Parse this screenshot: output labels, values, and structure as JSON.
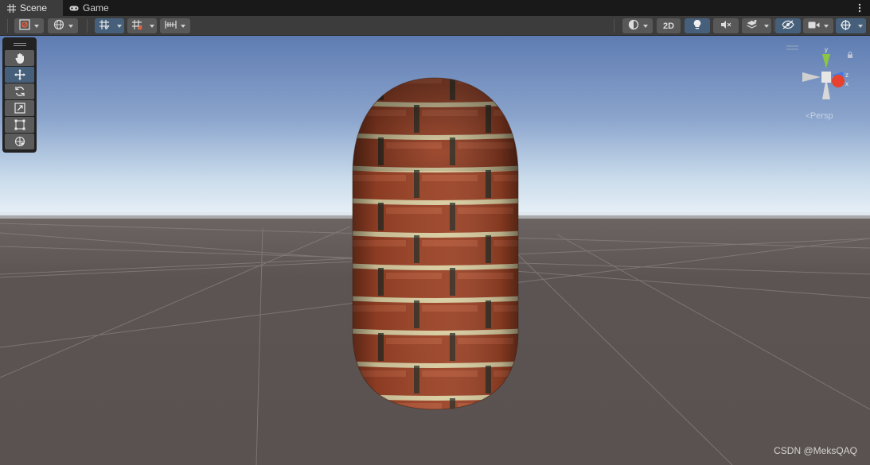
{
  "tabs": [
    {
      "label": "Scene",
      "icon": "grid-icon",
      "active": true
    },
    {
      "label": "Game",
      "icon": "gamepad-icon",
      "active": false
    }
  ],
  "toolbar": {
    "toggle_2d_label": "2D"
  },
  "tools": [
    "hand-tool",
    "move-tool",
    "rotate-tool",
    "scale-tool",
    "rect-tool",
    "transform-tool"
  ],
  "gizmo": {
    "axes": [
      "y",
      "z",
      "x"
    ],
    "projection_label": "Persp"
  },
  "watermark": "CSDN @MeksQAQ",
  "colors": {
    "toolbar": "#3c3c3c",
    "active_button": "#46607c",
    "sky_top": "#5d7bb0",
    "horizon": "#e4eef6",
    "ground": "#5a5350",
    "brick": "#a8482a",
    "mortar": "#d8cca0"
  }
}
